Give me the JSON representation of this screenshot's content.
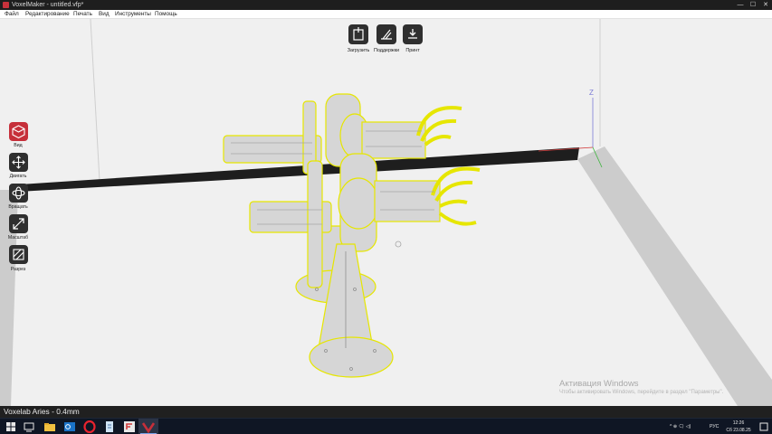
{
  "window": {
    "title": "VoxelMaker - untitled.vfp*",
    "min_symbol": "—",
    "max_symbol": "☐",
    "close_symbol": "✕"
  },
  "menu": [
    "Файл",
    "Редактирование",
    "Печать",
    "Вид",
    "Инструменты",
    "Помощь"
  ],
  "toolbar": {
    "load_label": "Загрузить",
    "supports_label": "Поддержки",
    "print_label": "Принт"
  },
  "sidebar": {
    "items": [
      {
        "label": "Вид",
        "icon": "view-cube-icon",
        "active": true
      },
      {
        "label": "Двигать",
        "icon": "move-icon",
        "active": false
      },
      {
        "label": "Вращать",
        "icon": "rotate-icon",
        "active": false
      },
      {
        "label": "Масштаб",
        "icon": "scale-icon",
        "active": false
      },
      {
        "label": "Разрез",
        "icon": "cut-icon",
        "active": false
      }
    ]
  },
  "axes": {
    "z_label": "Z"
  },
  "watermark": {
    "title": "Активация Windows",
    "subtitle": "Чтобы активировать Windows, перейдите в раздел \"Параметры\"."
  },
  "status": {
    "printer": "Voxelab Aries - 0.4mm"
  },
  "taskbar": {
    "tray_language": "РУС",
    "tray_symbols": "^ ⊕ 🗨 ◁)",
    "time": "12:26",
    "date": "Сб 23.08.25"
  },
  "colors": {
    "accent_red": "#c62f3a",
    "button_dark": "#2f2f2f",
    "model_outline": "#e6e600",
    "model_fill": "#d6d6d6",
    "bed_stripe": "#1e1e1e"
  }
}
